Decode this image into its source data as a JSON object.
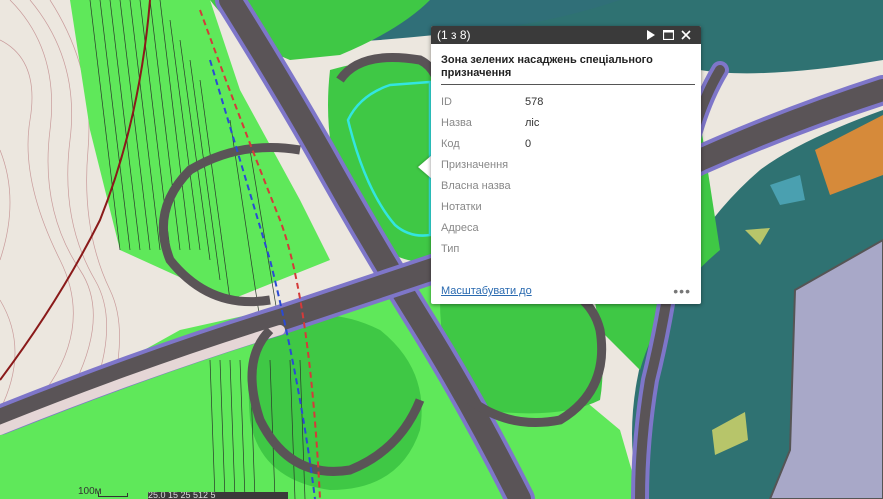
{
  "map": {
    "colors": {
      "background": "#e9e4dc",
      "green_bright": "#5fe85a",
      "green_mid": "#3fc845",
      "green_dark": "#2e8f3e",
      "teal": "#2f7070",
      "road": "#5a5457",
      "road_edge": "#7e76c9",
      "contour": "#b07070",
      "highlight": "#33e5e0",
      "orange": "#d68a3a",
      "building": "#a9a8c6"
    },
    "scale_label": "100м",
    "coords_text": "25.0 15 25 512 5"
  },
  "popup": {
    "counter": "(1 з 8)",
    "icons": {
      "next": "play-icon",
      "maximize": "maximize-icon",
      "close": "close-icon"
    },
    "title": "Зона зелених насаджень спеціального призначення",
    "fields": [
      {
        "label": "ID",
        "value": "578"
      },
      {
        "label": "Назва",
        "value": "ліс"
      },
      {
        "label": "Код",
        "value": "0"
      },
      {
        "label": "Призначення",
        "value": ""
      },
      {
        "label": "Власна назва",
        "value": ""
      },
      {
        "label": "Нотатки",
        "value": ""
      },
      {
        "label": "Адреса",
        "value": ""
      },
      {
        "label": "Тип",
        "value": ""
      }
    ],
    "zoom_link": "Масштабувати до",
    "more": "•••"
  }
}
